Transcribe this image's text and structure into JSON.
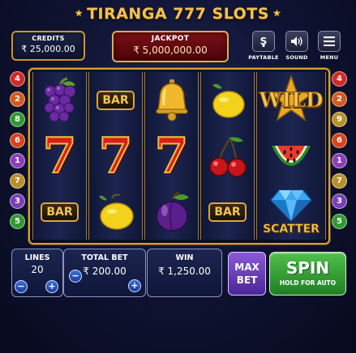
{
  "title": "TIRANGA 777 SLOTS",
  "header": {
    "credits": {
      "label": "CREDITS",
      "value": "₹ 25,000.00"
    },
    "jackpot": {
      "label": "JACKPOT",
      "value": "₹ 5,000,000.00"
    },
    "buttons": [
      {
        "label": "PAYTABLE",
        "icon": "paytable-icon"
      },
      {
        "label": "SOUND",
        "icon": "speaker-icon"
      },
      {
        "label": "MENU",
        "icon": "hamburger-icon"
      }
    ]
  },
  "paylines_left": [
    "4",
    "2",
    "8",
    "6",
    "1",
    "7",
    "3",
    "5"
  ],
  "paylines_right": [
    "4",
    "2",
    "9",
    "6",
    "1",
    "7",
    "3",
    "5"
  ],
  "reels": [
    [
      "grapes",
      "seven",
      "bar"
    ],
    [
      "bar",
      "seven",
      "lemon"
    ],
    [
      "bell",
      "seven",
      "plum"
    ],
    [
      "lemon",
      "cherries",
      "bar"
    ],
    [
      "wild",
      "watermelon",
      "scatter"
    ]
  ],
  "symbols": {
    "bar_text": "BAR",
    "seven_text": "7",
    "wild_text": "WILD",
    "scatter_text": "SCATTER"
  },
  "controls": {
    "lines": {
      "label": "LINES",
      "value": "20"
    },
    "total_bet": {
      "label": "TOTAL BET",
      "value": "₹ 200.00"
    },
    "win": {
      "label": "WIN",
      "value": "₹ 1,250.00"
    },
    "max_bet": "MAX BET",
    "spin": {
      "label": "SPIN",
      "sub": "HOLD FOR AUTO"
    },
    "minus": "−",
    "plus": "+"
  },
  "colors": {
    "gold": "#f2c14e",
    "jackpot_red": "#7a0e16",
    "spin_green": "#2e9a30",
    "max_bet_purple": "#6a3fc0",
    "payline_colors": {
      "1": "#8a3fb8",
      "2": "#d8581c",
      "3": "#7a3fb8",
      "4": "#d02a2a",
      "5": "#2e9a30",
      "6": "#d8421c",
      "7": "#b8902a",
      "8": "#2e9a30",
      "9": "#b8902a"
    }
  }
}
